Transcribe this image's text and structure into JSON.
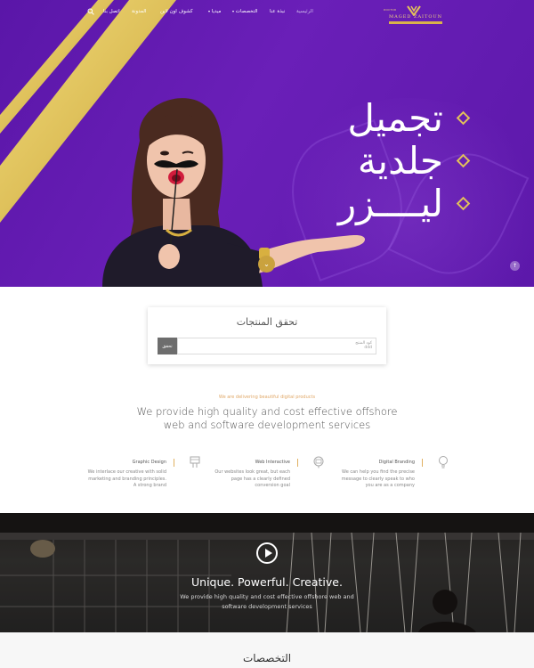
{
  "nav": {
    "items": [
      {
        "label": "الرئيسية",
        "dropdown": false
      },
      {
        "label": "نبذة عنا",
        "dropdown": false
      },
      {
        "label": "التخصصات",
        "dropdown": true
      },
      {
        "label": "ميديا",
        "dropdown": true
      },
      {
        "label": "كشوف اون لاين",
        "dropdown": false
      },
      {
        "label": "المدونة",
        "dropdown": false
      },
      {
        "label": "اتصل بنا",
        "dropdown": false
      }
    ],
    "search_icon": "search-icon"
  },
  "logo": {
    "small": "DOCTOR",
    "main": "MAGED ZAITOUN"
  },
  "hero": {
    "lines": [
      "تجميل",
      "جلدية",
      "ليــــزر"
    ],
    "accent_color": "#e2c15a",
    "bg_color": "#5c18aa"
  },
  "verify": {
    "title": "تحقق المنتجات",
    "button": "تحقق",
    "placeholder_line1": "كود المنتج",
    "placeholder_line2": "ddd"
  },
  "services": {
    "kicker": "We are delivering beautiful digital products",
    "headline": "We provide high quality and cost effective offshore web and software development services",
    "items": [
      {
        "title": "Digital Branding",
        "text": "We can help you find the precise message to clearly speak to who you are as a company",
        "icon": "lightbulb-icon"
      },
      {
        "title": "Web Interactive",
        "text": "Our websites look great, but each page has a clearly defined conversion goal",
        "icon": "monitor-icon"
      },
      {
        "title": "Graphic Design",
        "text": "We interlace our creative with solid marketing and branding principles. A strong brand",
        "icon": "design-icon"
      }
    ]
  },
  "video": {
    "title": "Unique. Powerful. Creative.",
    "subtitle": "We provide high quality and cost effective offshore web and software development services"
  },
  "bottom": {
    "title": "التخصصات"
  }
}
